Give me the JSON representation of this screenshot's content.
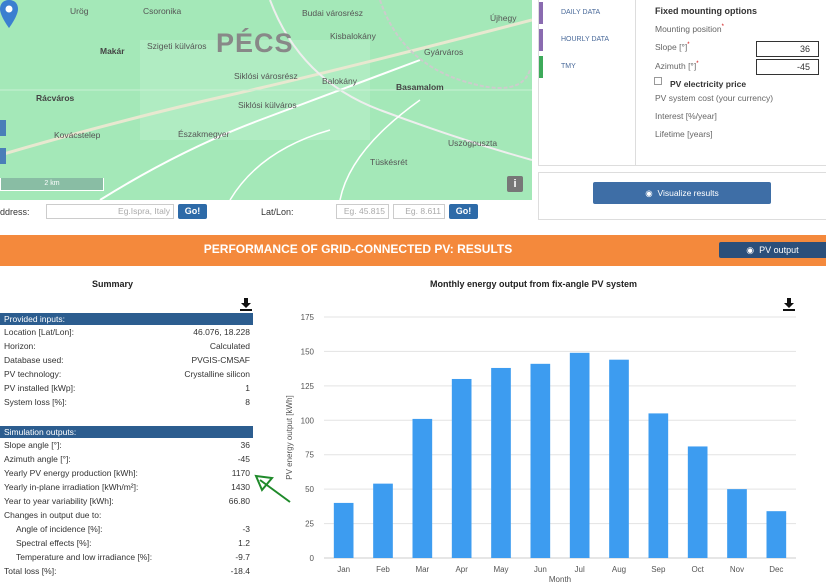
{
  "map": {
    "city": "PÉCS",
    "places": {
      "urog": "Urög",
      "csoronika": "Csoronika",
      "budai": "Budai városrész",
      "ujhegy": "Újhegy",
      "makar": "Makár",
      "szigeti": "Szigeti külváros",
      "kisbalokany": "Kisbalokány",
      "gyarvaros": "Gyárváros",
      "siklosi": "Siklósi városrész",
      "balokany": "Balokány",
      "basamalom": "Basamalom",
      "racvaros": "Rácváros",
      "siklosi_kulvaros": "Siklósi külváros",
      "kovacstelep": "Kovácstelep",
      "eszakmegyer": "Északmegyer",
      "uszogpuszta": "Uszögpuszta",
      "tuskesret": "Tüskésrét"
    },
    "scale_label": "2 km",
    "info_label": "i"
  },
  "address": {
    "label": "ddress:",
    "placeholder": "Eg.Ispra, Italy",
    "go": "Go!",
    "latlon_label": "Lat/Lon:",
    "lat_placeholder": "Eg. 45.815",
    "lon_placeholder": "Eg. 8.611"
  },
  "tabs": [
    {
      "label": "DAILY DATA",
      "color": "#8a6bb0"
    },
    {
      "label": "HOURLY DATA",
      "color": "#8a6bb0"
    },
    {
      "label": "TMY",
      "color": "#3daa5a"
    }
  ],
  "options": {
    "heading": "Fixed mounting options",
    "mounting_position": "Mounting position",
    "slope_label": "Slope [°]",
    "slope_value": "36",
    "azimuth_label": "Azimuth [°]",
    "azimuth_value": "-45",
    "pv_price": "PV electricity price",
    "system_cost": "PV system cost (your currency)",
    "interest": "Interest [%/year]",
    "lifetime": "Lifetime [years]"
  },
  "visualize": "Visualize results",
  "banner": {
    "title": "PERFORMANCE OF GRID-CONNECTED PV: RESULTS",
    "pv_output": "PV output"
  },
  "summary": {
    "title": "Summary",
    "provided_heading": "Provided inputs:",
    "provided": [
      {
        "k": "Location [Lat/Lon]:",
        "v": "46.076, 18.228"
      },
      {
        "k": "Horizon:",
        "v": "Calculated"
      },
      {
        "k": "Database used:",
        "v": "PVGIS-CMSAF"
      },
      {
        "k": "PV technology:",
        "v": "Crystalline silicon"
      },
      {
        "k": "PV installed [kWp]:",
        "v": "1"
      },
      {
        "k": "System loss [%]:",
        "v": "8"
      }
    ],
    "sim_heading": "Simulation outputs:",
    "sim": [
      {
        "k": "Slope angle [°]:",
        "v": "36"
      },
      {
        "k": "Azimuth angle [°]:",
        "v": "-45"
      },
      {
        "k": "Yearly PV energy production [kWh]:",
        "v": "1170"
      },
      {
        "k": "Yearly in-plane irradiation [kWh/m²]:",
        "v": "1430"
      },
      {
        "k": "Year to year variability [kWh]:",
        "v": "66.80"
      },
      {
        "k": "Changes in output due to:",
        "v": ""
      },
      {
        "k": "   Angle of incidence [%]:",
        "v": "-3"
      },
      {
        "k": "   Spectral effects [%]:",
        "v": "1.2"
      },
      {
        "k": "   Temperature and low irradiance [%]:",
        "v": "-9.7"
      },
      {
        "k": "Total loss [%]:",
        "v": "-18.4"
      }
    ]
  },
  "chart_title": "Monthly energy output from fix-angle PV system",
  "chart_data": {
    "type": "bar",
    "title": "Monthly energy output from fix-angle PV system",
    "categories": [
      "Jan",
      "Feb",
      "Mar",
      "Apr",
      "May",
      "Jun",
      "Jul",
      "Aug",
      "Sep",
      "Oct",
      "Nov",
      "Dec"
    ],
    "values": [
      40,
      54,
      101,
      130,
      138,
      141,
      149,
      144,
      105,
      81,
      50,
      34
    ],
    "xlabel": "Month",
    "ylabel": "PV energy output [kWh]",
    "ylim": [
      0,
      175
    ],
    "yticks": [
      0,
      25,
      50,
      75,
      100,
      125,
      150,
      175
    ],
    "grid": true,
    "bar_color": "#3d9cf0"
  },
  "colors": {
    "banner": "#f4893c",
    "section": "#2c5d8f",
    "button": "#2d6aa8",
    "annotation_arrow": "#1f8a2a"
  }
}
